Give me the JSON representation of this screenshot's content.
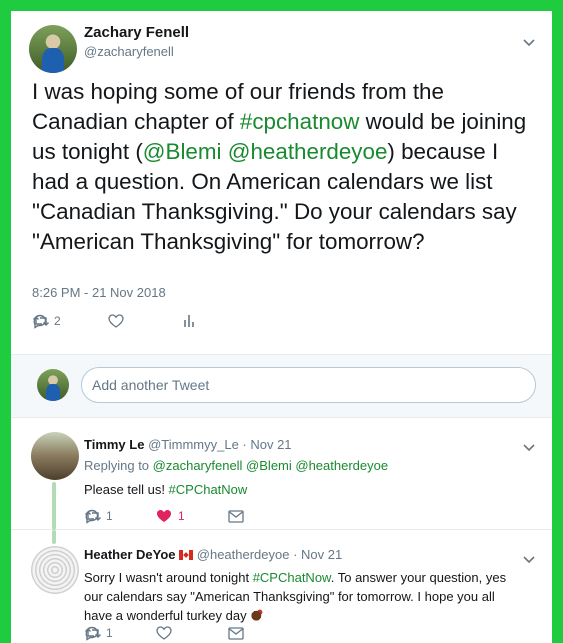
{
  "main_tweet": {
    "author_name": "Zachary Fenell",
    "author_handle": "@zacharyfenell",
    "text_parts": {
      "p1": "I was hoping some of our friends from the Canadian chapter of ",
      "tag1": "#cpchatnow",
      "p2": " would be joining us tonight (",
      "tag2": "@Blemi",
      "p3": " ",
      "tag3": "@heatherdeyoe",
      "p4": ") because I had a question. On American calendars we list \"Canadian Thanksgiving.\" Do your calendars say \"American Thanksgiving\" for tomorrow?"
    },
    "timestamp": "8:26 PM - 21 Nov 2018",
    "reply_count": "2"
  },
  "compose": {
    "placeholder": "Add another Tweet"
  },
  "replies": [
    {
      "name": "Timmy Le",
      "meta": "@Timmmyy_Le · Nov 21",
      "replying_prefix": "Replying to ",
      "replying_to": "@zacharyfenell @Blemi @heatherdeyoe",
      "text": "Please tell us! ",
      "tag": "#CPChatNow",
      "reply_count": "1",
      "like_count": "1"
    },
    {
      "name": "Heather DeYoe",
      "meta": "@heatherdeyoe · Nov 21",
      "text_a": "Sorry I wasn't around tonight ",
      "tag": "#CPChatNow",
      "text_b": ". To answer your question, yes our calendars say \"American Thanksgiving\" for tomorrow.  I hope you all have a wonderful turkey day ",
      "reply_count": "1"
    }
  ],
  "colors": {
    "border": "#1fcc3f",
    "link": "#1a8a30",
    "like": "#e0245e",
    "muted": "#657786"
  }
}
